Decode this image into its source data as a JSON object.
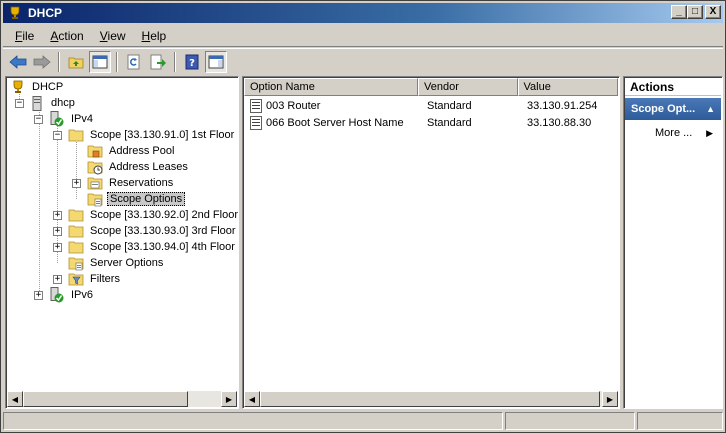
{
  "window": {
    "title": "DHCP",
    "minimize": "_",
    "maximize": "□",
    "close": "X"
  },
  "menu": {
    "file_pre": "",
    "file_hot": "F",
    "file_post": "ile",
    "action_pre": "",
    "action_hot": "A",
    "action_post": "ction",
    "view_pre": "",
    "view_hot": "V",
    "view_post": "iew",
    "help_pre": "",
    "help_hot": "H",
    "help_post": "elp"
  },
  "tree": {
    "root": "DHCP",
    "server": "dhcp",
    "ipv4": "IPv4",
    "scope1": "Scope [33.130.91.0] 1st Floor",
    "address_pool": "Address Pool",
    "address_leases": "Address Leases",
    "reservations": "Reservations",
    "scope_options": "Scope Options",
    "scope2": "Scope [33.130.92.0] 2nd Floor",
    "scope3": "Scope [33.130.93.0] 3rd Floor",
    "scope4": "Scope [33.130.94.0] 4th Floor",
    "server_options": "Server Options",
    "filters": "Filters",
    "ipv6": "IPv6",
    "expand_minus": "−",
    "expand_plus": "+"
  },
  "list": {
    "columns": [
      "Option Name",
      "Vendor",
      "Value"
    ],
    "rows": [
      {
        "name": "003 Router",
        "vendor": "Standard",
        "value": "33.130.91.254"
      },
      {
        "name": "066 Boot Server Host Name",
        "vendor": "Standard",
        "value": "33.130.88.30"
      }
    ]
  },
  "actions": {
    "title": "Actions",
    "section": "Scope Opt...",
    "section_arrow": "▲",
    "more": "More ...",
    "more_arrow": "▶"
  },
  "scrollbar": {
    "left_arrow": "◀",
    "right_arrow": "▶"
  },
  "colors": {
    "accent": "#2e5c9a",
    "title_gradient_start": "#0a246a"
  }
}
